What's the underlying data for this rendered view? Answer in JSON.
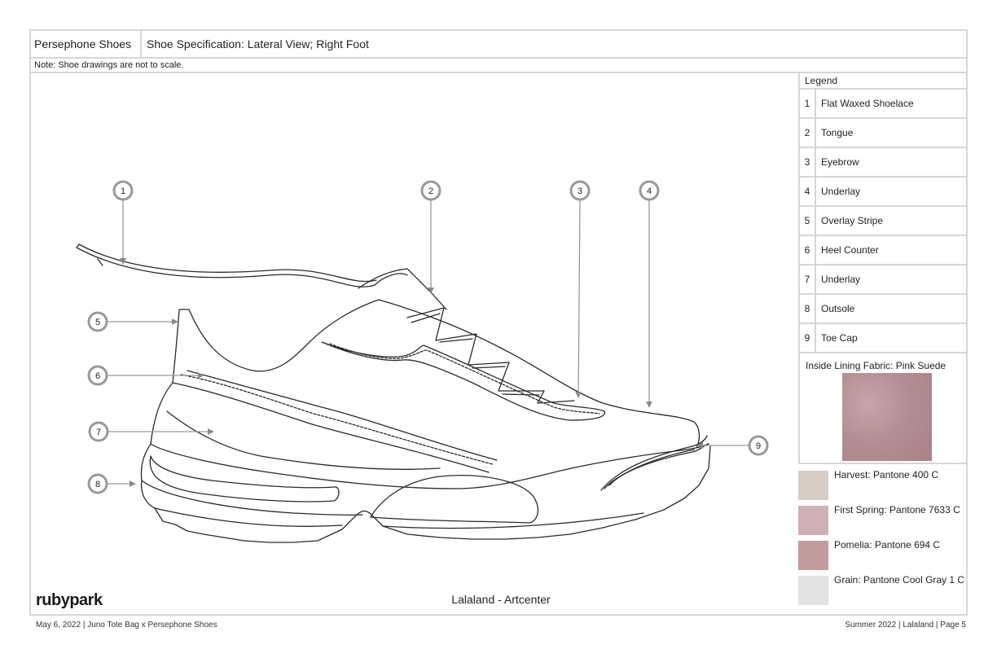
{
  "header": {
    "brand": "Persephone Shoes",
    "title": "Shoe Specification: Lateral View; Right Foot"
  },
  "note": "Note: Shoe drawings are not to scale.",
  "callouts": [
    "1",
    "2",
    "3",
    "4",
    "5",
    "6",
    "7",
    "8",
    "9"
  ],
  "legend": {
    "title": "Legend",
    "items": [
      {
        "num": "1",
        "label": "Flat Waxed Shoelace"
      },
      {
        "num": "2",
        "label": "Tongue"
      },
      {
        "num": "3",
        "label": "Eyebrow"
      },
      {
        "num": "4",
        "label": "Underlay"
      },
      {
        "num": "5",
        "label": "Overlay Stripe"
      },
      {
        "num": "6",
        "label": "Heel Counter"
      },
      {
        "num": "7",
        "label": "Underlay"
      },
      {
        "num": "8",
        "label": "Outsole"
      },
      {
        "num": "9",
        "label": "Toe Cap"
      }
    ]
  },
  "lining": {
    "title": "Inside Lining Fabric: Pink Suede"
  },
  "colors": [
    {
      "label": "Harvest: Pantone 400 C",
      "hex": "#d5cdc6"
    },
    {
      "label": "First Spring: Pantone 7633 C",
      "hex": "#cfb1b5"
    },
    {
      "label": "Pomelia: Pantone 694 C",
      "hex": "#c19b9e"
    },
    {
      "label": "Grain: Pantone Cool Gray 1 C",
      "hex": "#e3e3e4"
    }
  ],
  "caption": "Lalaland - Artcenter",
  "logo": "rubypark",
  "footer": {
    "left": "May 6, 2022    |    Juno Tote Bag x Persephone Shoes",
    "right": "Summer 2022    |    Lalaland    |    Page 5"
  }
}
